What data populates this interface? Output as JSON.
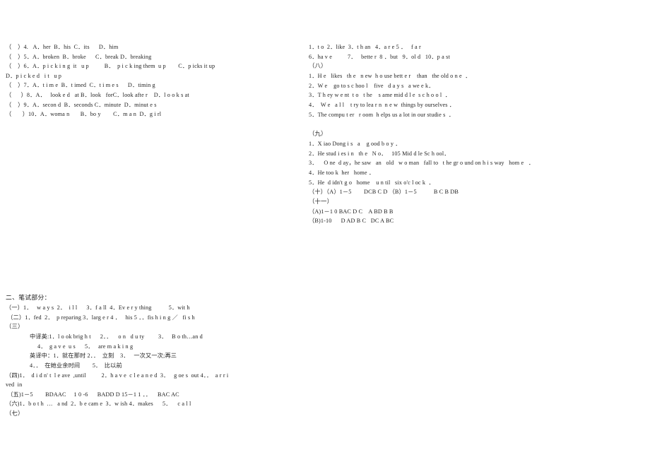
{
  "document": {
    "type": "scanned-answer-key",
    "background_color": "#ffffff",
    "text_color": "#1d1d1d"
  },
  "left_column": {
    "lines": [
      "（    ）4.   A．her  B．his  C．its      D．him",
      "（    ）5．A．broken  B．broke      C．break D．breaking",
      "（    ）6．A．p i c k i n g  it   u p          B．  p i c k ing them  u p        C．p icks it up",
      "D．p i c k e d   i t   u p",
      "（    ）7．A．t i m e  B．t imed  C．t i m e s      D．timin g",
      "（      ）8．A．   look e d   at B．look   forC．look afte r    D．l o o k s at",
      "（    ）9．A．secon d  B．seconds C．minute  D．minut e s",
      "（       ）10．A．woma n       B．bo y        C．m a n  D．g i rl"
    ]
  },
  "right_column": {
    "answer_line_1": "1．t o  2．like  3．t h an   4．a r e 5 ．   f a r",
    "answer_line_2": "6．ha v e          7．   bette r  8 ．but   9．ol d   10．p a st",
    "section_eight": {
      "label": "（八）",
      "sentences": [
        "1．H e   likes   th e   n ew  h o use bett e r    than   the old o n e  ．",
        "2．W e    go to s c hoo l    five   d a y s   a we e k．",
        "3．T h ey w e nt  t o   t he    s ame mid d l e  s c h o o l  ．",
        "4．  W e   a l l    t ry to lea r n  n e w  things by ourselves ．",
        "5．The compu t er   r oom  h elps us a lot in our studie s  ．"
      ]
    },
    "section_nine": {
      "label": "（九）",
      "sentences": [
        "1．X iao Dong i s   a    g ood b o y ．",
        "2．He stud i es i n   th e   N o．   105 Mid d le Sc h ool．",
        "3．    O ne  d ay，he saw   an   old   w o man   fall to   t he gr o und on h i s way   hom e   ．",
        "4．He too k  her   home ．",
        "5．He  d idn't g o   home    u n til   six o'c l oc k  ．"
      ]
    },
    "section_ten": "（十）（A）1－5        DCB C D （B）1－5           B C B DB",
    "section_eleven": {
      "label": "（十一）",
      "lines": [
        "（A)1－1 0 BAC D C    A BD B B",
        "（B)1-10      D AD B C   DC A BC"
      ]
    }
  },
  "bottom_section": {
    "heading": "二、笔试部分：",
    "part_one": "（一）1．   w a y s  2．  i l l      3．f a ll  4．Ev e r y thing           5．wit h",
    "part_two": " （二）1．fed  2．  p reparing 3．larg e r 4 ．   his 5 ．．fis h i n g ／   fi s h",
    "part_three": {
      "label": "（三）",
      "cn_to_en_label": "中译英:",
      "cn_to_en_line1": "中译英:1．l o ok brig h t      2．．    o n   d u ty         3．   B o th…an d",
      "cn_to_en_line2": "     4．  g a v e  u s      5．   are m a k i n g",
      "en_to_cn_line1": "英译中：1．就在那时 2．．  立刻    3．   一次又一次;再三",
      "en_to_cn_line2": "4．．  在她业余时间        5．  比以前"
    },
    "part_four_line1": "（四)1．  d i d n' t  l e ave  ,until          2．h a v e  c l e a n e d  3．   g oe s  out 4．．  a r r i",
    "part_four_line2": "ved  in",
    "part_five": " （五)1－5        BDAAC     1 0 -6      BADD D 15－1 1 ．．    BAC AC",
    "part_six": "（六)1．b o t h  …   a nd  2．b e cam e  3．w ish 4．makes      5．    c a l l",
    "part_seven": "（七）"
  }
}
